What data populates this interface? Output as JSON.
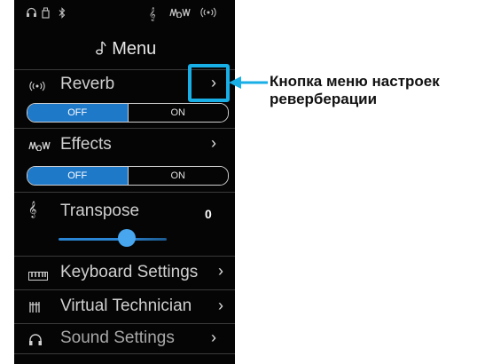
{
  "status_bar": {
    "icons": [
      "headphones-icon",
      "usb-drive-icon",
      "bluetooth-icon",
      "treble-clef-icon",
      "effects-icon",
      "reverb-icon"
    ]
  },
  "menu": {
    "title": "Menu",
    "title_icon": "note-icon"
  },
  "reverb": {
    "label": "Reverb",
    "icon": "reverb-icon",
    "off_label": "OFF",
    "on_label": "ON",
    "state": "OFF"
  },
  "effects": {
    "label": "Effects",
    "icon": "effects-icon",
    "off_label": "OFF",
    "on_label": "ON",
    "state": "OFF"
  },
  "transpose": {
    "label": "Transpose",
    "icon": "treble-clef-icon",
    "value": "0",
    "slider_fraction": 0.55
  },
  "items": [
    {
      "label": "Keyboard Settings",
      "icon": "keyboard-icon"
    },
    {
      "label": "Virtual Technician",
      "icon": "technician-icon"
    },
    {
      "label": "Sound Settings",
      "icon": "headphones-icon"
    }
  ],
  "callout": {
    "line1": "Кнопка меню настроек",
    "line2": "реверберации"
  },
  "colors": {
    "accent": "#1f79c9",
    "highlight": "#18aee6"
  }
}
